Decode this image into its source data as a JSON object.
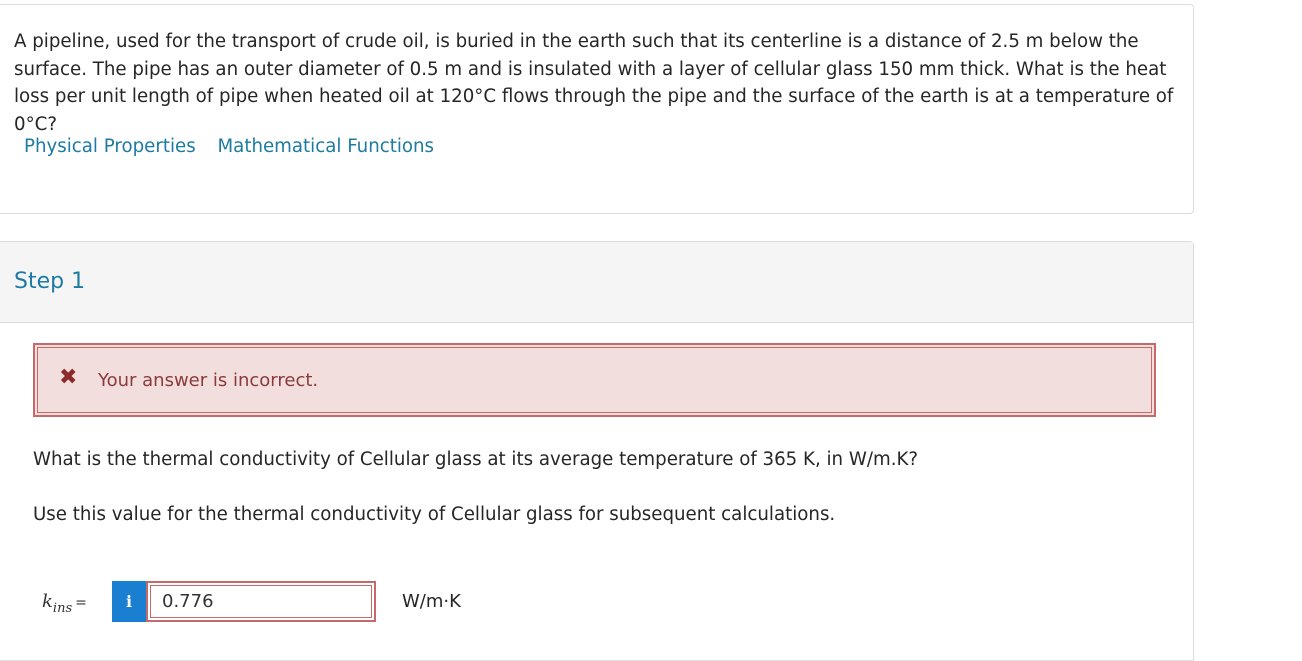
{
  "question": {
    "text": "A pipeline, used for the transport of crude oil, is buried in the earth such that its centerline is a distance of 2.5 m below the surface. The pipe has an outer diameter of 0.5 m and is insulated with a layer of cellular glass 150 mm thick. What is the heat loss per unit length of pipe when heated oil at 120°C flows through the pipe and the surface of the earth is at a temperature of 0°C?",
    "links": [
      "Physical Properties",
      "Mathematical Functions"
    ]
  },
  "step": {
    "title": "Step 1",
    "feedback": "Your answer is incorrect.",
    "prompt": "What is the thermal conductivity of Cellular glass at its average temperature of 365 K, in W/m.K?",
    "instruction": "Use this value for the thermal conductivity of Cellular glass for subsequent calculations.",
    "answer": {
      "variable": "k",
      "subscript": "ins",
      "equals": "=",
      "info_glyph": "i",
      "value": "0.776",
      "unit": "W/m·K"
    }
  },
  "colors": {
    "link": "#1d7ba3",
    "error_border": "#c46a6a",
    "error_bg": "#f3dede",
    "info_button": "#1a7fd0"
  },
  "icons": [
    "close-icon",
    "info-icon"
  ]
}
